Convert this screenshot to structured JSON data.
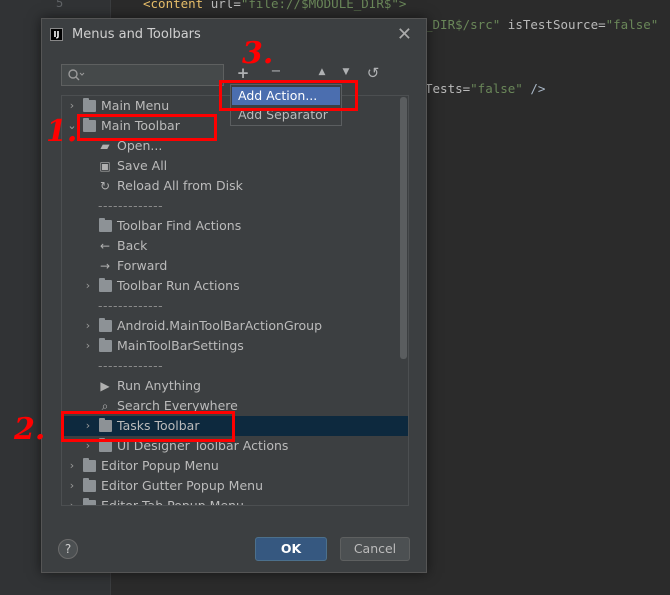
{
  "editor": {
    "line_number": "5",
    "line1_tag": "<content",
    "line1_attr": " url=",
    "line1_val": "\"file://$MODULE_DIR$\">",
    "line2_val": "_DIR$/src\"",
    "line2_attr": " isTestSource=",
    "line2_val2": "\"false\"",
    "line3_attr": "Tests=",
    "line3_val": "\"false\"",
    "line3_end": " />"
  },
  "dialog": {
    "title": "Menus and Toolbars",
    "app_icon_text": "IJ",
    "close_glyph": "✕",
    "search_placeholder": "",
    "toolbar": {
      "add_glyph": "+",
      "remove_glyph": "−",
      "up_glyph": "▲",
      "down_glyph": "▼",
      "restore_glyph": "↺"
    },
    "add_menu": [
      {
        "label": "Add Action..."
      },
      {
        "label": "Add Separator"
      }
    ],
    "tree": [
      {
        "label": "Main Menu",
        "arrow": "›",
        "icon": "folder-icon"
      },
      {
        "label": "Main Toolbar",
        "arrow": "⌄",
        "icon": "folder-icon"
      },
      {
        "label": "Open...",
        "icon": "open-icon",
        "glyph": "▰"
      },
      {
        "label": "Save All",
        "icon": "save-icon",
        "glyph": "▣"
      },
      {
        "label": "Reload All from Disk",
        "icon": "reload-icon",
        "glyph": "↻"
      },
      {
        "label": "-------------",
        "separator": true
      },
      {
        "label": "Toolbar Find Actions",
        "icon": "folder-icon"
      },
      {
        "label": "Back",
        "icon": "back-icon",
        "glyph": "←"
      },
      {
        "label": "Forward",
        "icon": "forward-icon",
        "glyph": "→"
      },
      {
        "label": "Toolbar Run Actions",
        "arrow": "›",
        "icon": "folder-icon"
      },
      {
        "label": "-------------",
        "separator": true
      },
      {
        "label": "Android.MainToolBarActionGroup",
        "arrow": "›",
        "icon": "folder-icon"
      },
      {
        "label": "MainToolBarSettings",
        "arrow": "›",
        "icon": "folder-icon"
      },
      {
        "label": "-------------",
        "separator": true
      },
      {
        "label": "Run Anything",
        "icon": "run-anything-icon",
        "glyph": "▶"
      },
      {
        "label": "Search Everywhere",
        "icon": "search-everywhere-icon",
        "glyph": "⌕"
      },
      {
        "label": "Tasks Toolbar",
        "arrow": "›",
        "icon": "folder-icon",
        "selected": true
      },
      {
        "label": "UI Designer Toolbar Actions",
        "arrow": "›",
        "icon": "folder-icon"
      },
      {
        "label": "Editor Popup Menu",
        "arrow": "›",
        "icon": "folder-icon"
      },
      {
        "label": "Editor Gutter Popup Menu",
        "arrow": "›",
        "icon": "folder-icon"
      },
      {
        "label": "Editor Tab Popup Menu",
        "arrow": "›",
        "icon": "folder-icon"
      }
    ],
    "help_label": "?",
    "ok_label": "OK",
    "cancel_label": "Cancel"
  },
  "annotations": {
    "mark1": "1.",
    "mark2": "2.",
    "mark3": "3.",
    "color": "#ff0000"
  },
  "colors": {
    "selection": "#0d293e",
    "menu_hover": "#4b6eaf",
    "ok_button": "#365880"
  }
}
